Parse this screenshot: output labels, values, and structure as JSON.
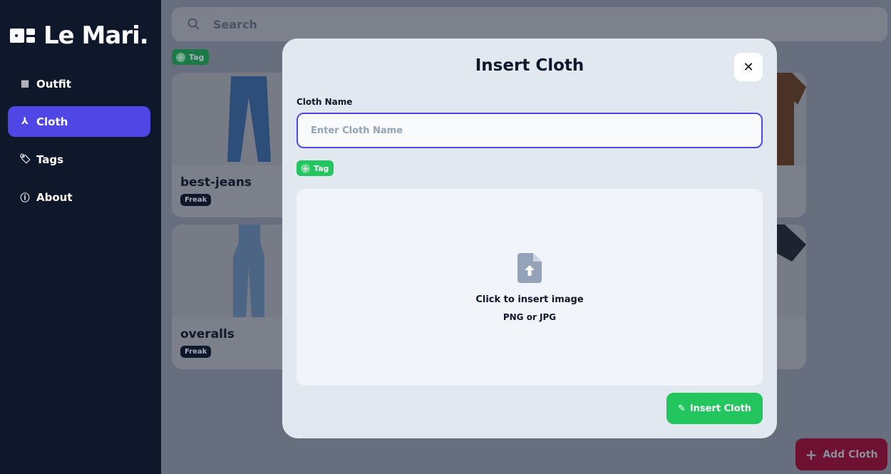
{
  "app": {
    "name": "Le Mari."
  },
  "sidebar": {
    "items": [
      {
        "label": "Outfit",
        "icon": "layout-icon"
      },
      {
        "label": "Cloth",
        "icon": "hanger-icon",
        "active": true
      },
      {
        "label": "Tags",
        "icon": "tag-icon"
      },
      {
        "label": "About",
        "icon": "info-icon"
      }
    ]
  },
  "main": {
    "search_placeholder": "Search",
    "tag_label": "Tag",
    "cards": [
      {
        "name": "best-jeans",
        "tag": "Freak"
      },
      {
        "name": "overalls",
        "tag": "Freak"
      }
    ],
    "add_cloth_label": "Add Cloth"
  },
  "modal": {
    "title": "Insert Cloth",
    "name_label": "Cloth Name",
    "name_placeholder": "Enter Cloth Name",
    "name_value": "",
    "tag_label": "Tag",
    "upload_text": "Click to insert image",
    "upload_formats": "PNG or JPG",
    "submit_label": "Insert Cloth"
  },
  "colors": {
    "accent": "#4f46e5",
    "success": "#22c55e",
    "sidebar": "#0f172a",
    "danger": "#be123c"
  }
}
